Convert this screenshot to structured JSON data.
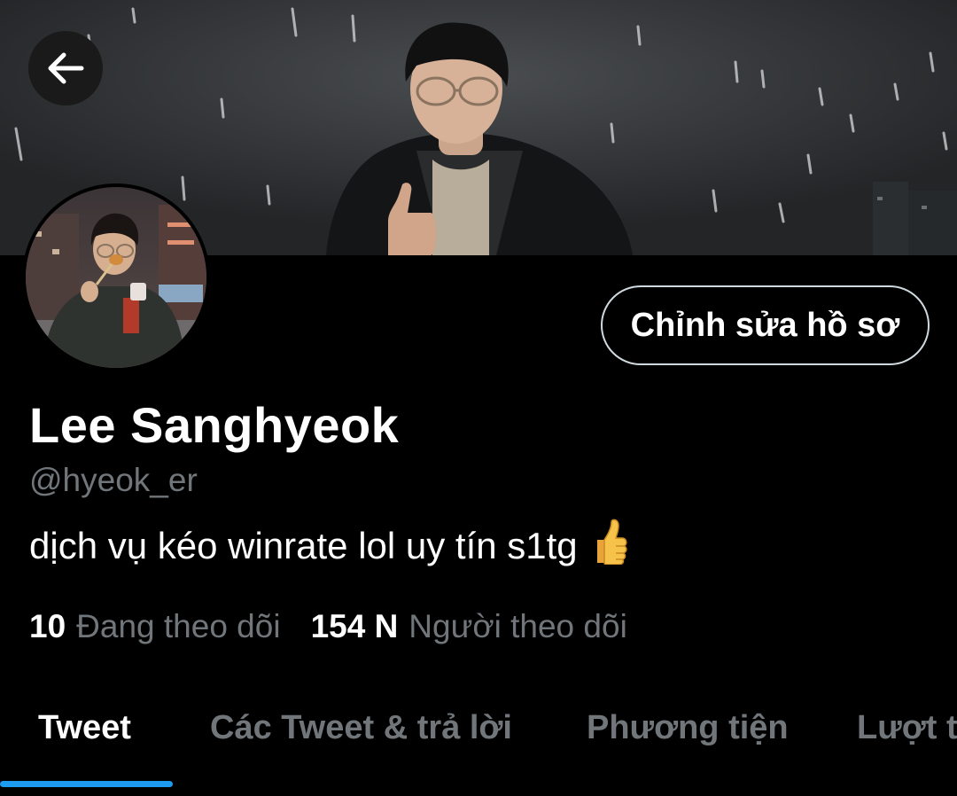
{
  "header": {
    "back_icon": "arrow-left-icon"
  },
  "profile": {
    "display_name": "Lee Sanghyeok",
    "handle": "@hyeok_er",
    "bio": "dịch vụ kéo winrate lol uy tín s1tg",
    "bio_emoji_icon": "thumbs-up-icon",
    "edit_profile_label": "Chỉnh sửa hồ sơ",
    "following_count": "10",
    "following_label": "Đang theo dõi",
    "followers_count": "154 N",
    "followers_label": "Người theo dõi"
  },
  "tabs": [
    {
      "label": "Tweet",
      "active": true
    },
    {
      "label": "Các Tweet & trả lời",
      "active": false
    },
    {
      "label": "Phương tiện",
      "active": false
    },
    {
      "label": "Lượt thích",
      "active": false
    }
  ],
  "colors": {
    "background": "#000000",
    "accent": "#1d9bf0",
    "text_primary": "#ffffff",
    "text_secondary": "#71767b"
  }
}
